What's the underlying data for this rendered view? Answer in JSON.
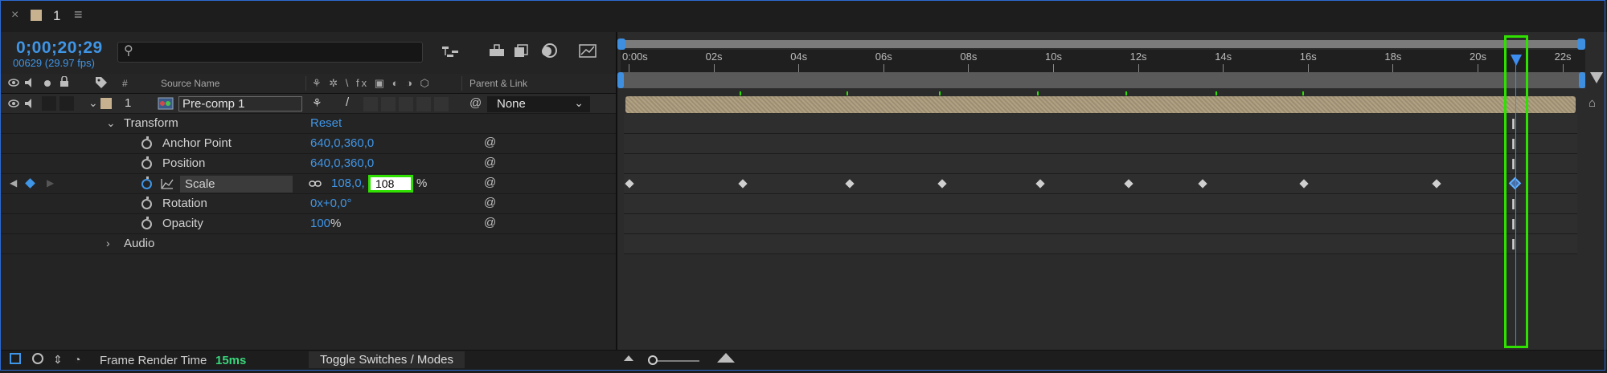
{
  "tab": {
    "close": "×",
    "title": "1",
    "menu": "≡"
  },
  "timecode": "0;00;20;29",
  "fps_readout": "00629 (29.97 fps)",
  "search": {
    "icon": "⚲",
    "placeholder": ""
  },
  "toolbar_icons": [
    "composition-flowchart-icon",
    "draft-3d-icon",
    "frame-blending-icon",
    "motion-blur-icon",
    "graph-editor-icon"
  ],
  "columns": {
    "source_name": "Source Name",
    "number": "#",
    "parent_link": "Parent & Link",
    "switches": "⚘ ✲ \\ fx ▣ ◐ ◑ ⬡"
  },
  "layer": {
    "number": "1",
    "name": "Pre-comp 1",
    "parent": "None",
    "switch_glyphs": [
      "⚘",
      "/"
    ]
  },
  "transform": {
    "label": "Transform",
    "reset": "Reset"
  },
  "properties": [
    {
      "name": "Anchor Point",
      "value": "640,0,360,0"
    },
    {
      "name": "Position",
      "value": "640,0,360,0"
    },
    {
      "name": "Scale",
      "value_a": "108,0,",
      "value_b": "108",
      "unit": "%"
    },
    {
      "name": "Rotation",
      "value_a": "0x",
      "value_b": "+0,0°"
    },
    {
      "name": "Opacity",
      "value_a": "100",
      "unit": "%"
    }
  ],
  "audio_label": "Audio",
  "ruler": [
    "0:00s",
    "02s",
    "04s",
    "06s",
    "08s",
    "10s",
    "12s",
    "14s",
    "16s",
    "18s",
    "20s",
    "22s"
  ],
  "scale_keyframe_count": 9,
  "bottom": {
    "frame_render_label": "Frame Render Time",
    "frame_render_value": "15ms",
    "toggle_label": "Toggle Switches / Modes"
  },
  "colors": {
    "accent": "#3f95e6",
    "highlight": "#2fe000",
    "layer_bar": "#a8987c"
  }
}
